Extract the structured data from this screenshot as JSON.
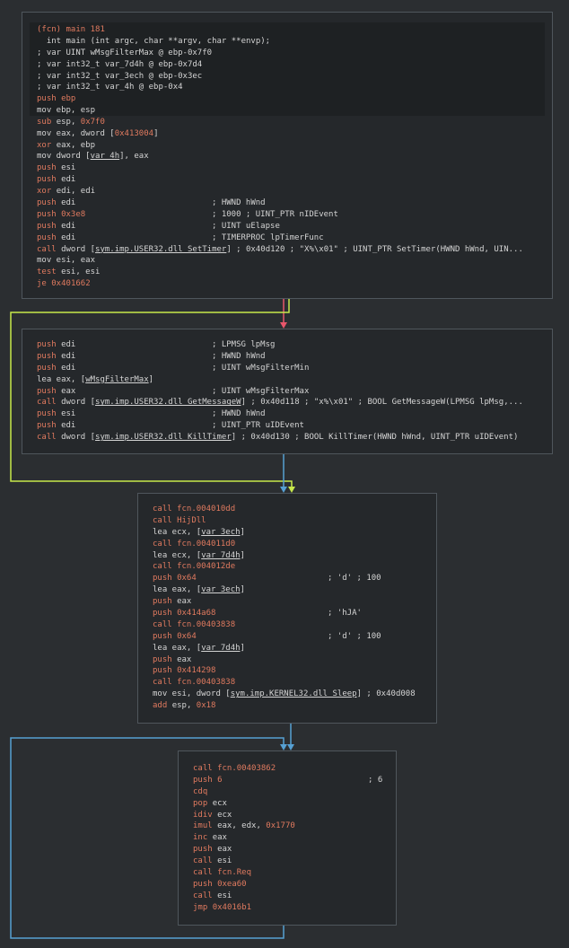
{
  "colors": {
    "true_edge": "#c7e84b",
    "false_edge": "#e8566b",
    "jump_edge": "#56a0d3",
    "background": "#2b2e31",
    "block_fill": "#25282b",
    "block_border": "#4f565c",
    "accent": "#e07a5f"
  },
  "blocks": [
    {
      "id": "block-main",
      "header": [
        [
          {
            "t": "(fcn) main 181",
            "c": "fcnname"
          }
        ],
        [
          {
            "t": "  int main (int argc, char **argv, char **envp);",
            "c": "plain"
          }
        ],
        [
          {
            "t": "; var UINT wMsgFilterMax @ ebp-0x7f0",
            "c": "plain"
          }
        ],
        [
          {
            "t": "; var int32_t var_7d4h @ ebp-0x7d4",
            "c": "plain"
          }
        ],
        [
          {
            "t": "; var int32_t var_3ech @ ebp-0x3ec",
            "c": "plain"
          }
        ],
        [
          {
            "t": "; var int32_t var_4h @ ebp-0x4",
            "c": "plain"
          }
        ]
      ],
      "lines": [
        [
          {
            "t": "push ebp",
            "c": "kw"
          }
        ],
        [
          {
            "t": "mov ebp, esp",
            "c": "plain"
          }
        ],
        [
          {
            "t": "sub ",
            "c": "kw"
          },
          {
            "t": "esp, ",
            "c": "plain"
          },
          {
            "t": "0x7f0",
            "c": "num"
          }
        ],
        [
          {
            "t": "mov eax, dword [",
            "c": "plain"
          },
          {
            "t": "0x413004",
            "c": "num"
          },
          {
            "t": "]",
            "c": "plain"
          }
        ],
        [
          {
            "t": "xor ",
            "c": "kw"
          },
          {
            "t": "eax, ebp",
            "c": "plain"
          }
        ],
        [
          {
            "t": "mov dword [",
            "c": "plain"
          },
          {
            "t": "var_4h",
            "c": "plain u"
          },
          {
            "t": "], eax",
            "c": "plain"
          }
        ],
        [
          {
            "t": "push ",
            "c": "kw"
          },
          {
            "t": "esi",
            "c": "plain"
          }
        ],
        [
          {
            "t": "push ",
            "c": "kw"
          },
          {
            "t": "edi",
            "c": "plain"
          }
        ],
        [
          {
            "t": "xor ",
            "c": "kw"
          },
          {
            "t": "edi, edi",
            "c": "plain"
          }
        ],
        [
          {
            "t": "push ",
            "c": "kw"
          },
          {
            "t": "edi",
            "c": "plain"
          },
          {
            "t": "; HWND hWnd",
            "c": "cmt",
            "col": 195
          }
        ],
        [
          {
            "t": "push ",
            "c": "kw"
          },
          {
            "t": "0x3e8",
            "c": "num"
          },
          {
            "t": "; 1000 ; UINT_PTR nIDEvent",
            "c": "cmt",
            "col": 195
          }
        ],
        [
          {
            "t": "push ",
            "c": "kw"
          },
          {
            "t": "edi",
            "c": "plain"
          },
          {
            "t": "; UINT uElapse",
            "c": "cmt",
            "col": 195
          }
        ],
        [
          {
            "t": "push ",
            "c": "kw"
          },
          {
            "t": "edi",
            "c": "plain"
          },
          {
            "t": "; TIMERPROC lpTimerFunc",
            "c": "cmt",
            "col": 195
          }
        ],
        [
          {
            "t": "call ",
            "c": "kw"
          },
          {
            "t": "dword [",
            "c": "plain"
          },
          {
            "t": "sym.imp.USER32.dll_SetTimer",
            "c": "plain u"
          },
          {
            "t": "] ; 0x40d120 ; \"X%\\x01\" ; UINT_PTR SetTimer(HWND hWnd, UIN...",
            "c": "plain"
          }
        ],
        [
          {
            "t": "mov esi, eax",
            "c": "plain"
          }
        ],
        [
          {
            "t": "test ",
            "c": "kw"
          },
          {
            "t": "esi, esi",
            "c": "plain"
          }
        ],
        [
          {
            "t": "je ",
            "c": "kw"
          },
          {
            "t": "0x401662",
            "c": "num"
          }
        ]
      ]
    },
    {
      "id": "block-getmessage",
      "lines": [
        [
          {
            "t": "push ",
            "c": "kw"
          },
          {
            "t": "edi",
            "c": "plain"
          },
          {
            "t": "; LPMSG lpMsg",
            "c": "cmt",
            "col": 195
          }
        ],
        [
          {
            "t": "push ",
            "c": "kw"
          },
          {
            "t": "edi",
            "c": "plain"
          },
          {
            "t": "; HWND hWnd",
            "c": "cmt",
            "col": 195
          }
        ],
        [
          {
            "t": "push ",
            "c": "kw"
          },
          {
            "t": "edi",
            "c": "plain"
          },
          {
            "t": "; UINT wMsgFilterMin",
            "c": "cmt",
            "col": 195
          }
        ],
        [
          {
            "t": "lea eax, [",
            "c": "plain"
          },
          {
            "t": "wMsgFilterMax",
            "c": "plain u"
          },
          {
            "t": "]",
            "c": "plain"
          }
        ],
        [
          {
            "t": "push ",
            "c": "kw"
          },
          {
            "t": "eax",
            "c": "plain"
          },
          {
            "t": "; UINT wMsgFilterMax",
            "c": "cmt",
            "col": 195
          }
        ],
        [
          {
            "t": "call ",
            "c": "kw"
          },
          {
            "t": "dword [",
            "c": "plain"
          },
          {
            "t": "sym.imp.USER32.dll_GetMessageW",
            "c": "plain u"
          },
          {
            "t": "] ; 0x40d118 ; \"x%\\x01\" ; BOOL GetMessageW(LPMSG lpMsg,...",
            "c": "plain"
          }
        ],
        [
          {
            "t": "push ",
            "c": "kw"
          },
          {
            "t": "esi",
            "c": "plain"
          },
          {
            "t": "; HWND hWnd",
            "c": "cmt",
            "col": 195
          }
        ],
        [
          {
            "t": "push ",
            "c": "kw"
          },
          {
            "t": "edi",
            "c": "plain"
          },
          {
            "t": "; UINT_PTR uIDEvent",
            "c": "cmt",
            "col": 195
          }
        ],
        [
          {
            "t": "call ",
            "c": "kw"
          },
          {
            "t": "dword [",
            "c": "plain"
          },
          {
            "t": "sym.imp.USER32.dll_KillTimer",
            "c": "plain u"
          },
          {
            "t": "] ; 0x40d130 ; BOOL KillTimer(HWND hWnd, UINT_PTR uIDEvent)",
            "c": "plain"
          }
        ]
      ]
    },
    {
      "id": "block-setup",
      "lines": [
        [
          {
            "t": "call fcn.004010dd",
            "c": "kw"
          }
        ],
        [
          {
            "t": "call HijDll",
            "c": "kw"
          }
        ],
        [
          {
            "t": "lea ecx, [",
            "c": "plain"
          },
          {
            "t": "var_3ech",
            "c": "plain u"
          },
          {
            "t": "]",
            "c": "plain"
          }
        ],
        [
          {
            "t": "call fcn.004011d0",
            "c": "kw"
          }
        ],
        [
          {
            "t": "lea ecx, [",
            "c": "plain"
          },
          {
            "t": "var_7d4h",
            "c": "plain u"
          },
          {
            "t": "]",
            "c": "plain"
          }
        ],
        [
          {
            "t": "call fcn.004012de",
            "c": "kw"
          }
        ],
        [
          {
            "t": "push ",
            "c": "kw"
          },
          {
            "t": "0x64",
            "c": "num"
          },
          {
            "t": "; 'd' ; 100",
            "c": "cmt",
            "col": 195
          }
        ],
        [
          {
            "t": "lea eax, [",
            "c": "plain"
          },
          {
            "t": "var_3ech",
            "c": "plain u"
          },
          {
            "t": "]",
            "c": "plain"
          }
        ],
        [
          {
            "t": "push ",
            "c": "kw"
          },
          {
            "t": "eax",
            "c": "plain"
          }
        ],
        [
          {
            "t": "push ",
            "c": "kw"
          },
          {
            "t": "0x414a68",
            "c": "num"
          },
          {
            "t": "; 'hJA'",
            "c": "cmt",
            "col": 195
          }
        ],
        [
          {
            "t": "call fcn.00403838",
            "c": "kw"
          }
        ],
        [
          {
            "t": "push ",
            "c": "kw"
          },
          {
            "t": "0x64",
            "c": "num"
          },
          {
            "t": "; 'd' ; 100",
            "c": "cmt",
            "col": 195
          }
        ],
        [
          {
            "t": "lea eax, [",
            "c": "plain"
          },
          {
            "t": "var_7d4h",
            "c": "plain u"
          },
          {
            "t": "]",
            "c": "plain"
          }
        ],
        [
          {
            "t": "push ",
            "c": "kw"
          },
          {
            "t": "eax",
            "c": "plain"
          }
        ],
        [
          {
            "t": "push ",
            "c": "kw"
          },
          {
            "t": "0x414298",
            "c": "num"
          }
        ],
        [
          {
            "t": "call fcn.00403838",
            "c": "kw"
          }
        ],
        [
          {
            "t": "mov esi, dword [",
            "c": "plain"
          },
          {
            "t": "sym.imp.KERNEL32.dll_Sleep",
            "c": "plain u"
          },
          {
            "t": "] ; 0x40d008",
            "c": "plain"
          }
        ],
        [
          {
            "t": "add ",
            "c": "kw"
          },
          {
            "t": "esp, ",
            "c": "plain"
          },
          {
            "t": "0x18",
            "c": "num"
          }
        ]
      ]
    },
    {
      "id": "block-loop",
      "lines": [
        [
          {
            "t": "call fcn.00403862",
            "c": "kw"
          }
        ],
        [
          {
            "t": "push ",
            "c": "kw"
          },
          {
            "t": "6",
            "c": "num"
          },
          {
            "t": "; 6",
            "c": "cmt",
            "col": 195
          }
        ],
        [
          {
            "t": "cdq",
            "c": "kw"
          }
        ],
        [
          {
            "t": "pop ",
            "c": "kw"
          },
          {
            "t": "ecx",
            "c": "plain"
          }
        ],
        [
          {
            "t": "idiv ",
            "c": "kw"
          },
          {
            "t": "ecx",
            "c": "plain"
          }
        ],
        [
          {
            "t": "imul ",
            "c": "kw"
          },
          {
            "t": "eax, edx, ",
            "c": "plain"
          },
          {
            "t": "0x1770",
            "c": "num"
          }
        ],
        [
          {
            "t": "inc ",
            "c": "kw"
          },
          {
            "t": "eax",
            "c": "plain"
          }
        ],
        [
          {
            "t": "push ",
            "c": "kw"
          },
          {
            "t": "eax",
            "c": "plain"
          }
        ],
        [
          {
            "t": "call ",
            "c": "kw"
          },
          {
            "t": "esi",
            "c": "plain"
          }
        ],
        [
          {
            "t": "call fcn.Req",
            "c": "kw"
          }
        ],
        [
          {
            "t": "push ",
            "c": "kw"
          },
          {
            "t": "0xea60",
            "c": "num"
          }
        ],
        [
          {
            "t": "call ",
            "c": "kw"
          },
          {
            "t": "esi",
            "c": "plain"
          }
        ],
        [
          {
            "t": "jmp ",
            "c": "kw"
          },
          {
            "t": "0x4016b1",
            "c": "num"
          }
        ]
      ]
    }
  ]
}
